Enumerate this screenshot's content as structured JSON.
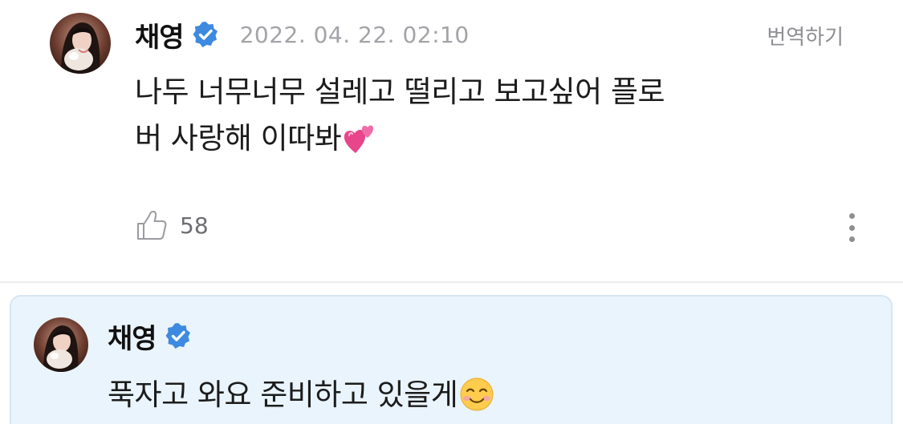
{
  "comment": {
    "author": "채영",
    "verified": true,
    "timestamp": "2022. 04. 22. 02:10",
    "translate_label": "번역하기",
    "body_line1": "나두 너무너무 설레고 떨리고 보고싶어 플로",
    "body_line2": "버 사랑해 이따봐",
    "body_emoji": "two-hearts-icon",
    "like_count": "58"
  },
  "reply": {
    "author": "채영",
    "verified": true,
    "body": "푹자고 와요 준비하고 있을게",
    "body_emoji": "smiling-face-icon"
  },
  "colors": {
    "verified_badge": "#3d8ae0",
    "reply_background": "#eaf4fc",
    "reply_border": "#d6e6f2",
    "timestamp": "#a3a3a8",
    "heart_pink": "#e8458b"
  }
}
